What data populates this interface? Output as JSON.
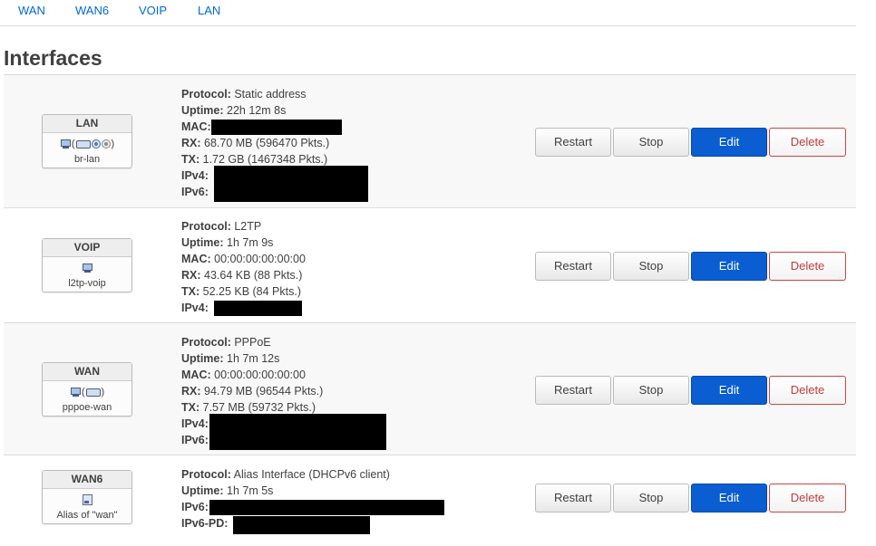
{
  "tabs": [
    "WAN",
    "WAN6",
    "VOIP",
    "LAN"
  ],
  "page_title": "Interfaces",
  "buttons": {
    "restart": "Restart",
    "stop": "Stop",
    "edit": "Edit",
    "delete": "Delete"
  },
  "interfaces": [
    {
      "name": "LAN",
      "device": "br-lan",
      "icons": [
        "ethernet-port-icon",
        "bridge-group-icon",
        "wireless-icon",
        "wireless-disabled-icon"
      ],
      "details": [
        {
          "label": "Protocol:",
          "value": " Static address"
        },
        {
          "label": "Uptime:",
          "value": " 22h 12m 8s"
        },
        {
          "label": "MAC:",
          "value": ""
        },
        {
          "label": "RX:",
          "value": " 68.70 MB (596470 Pkts.)"
        },
        {
          "label": "TX:",
          "value": " 1.72 GB (1467348 Pkts.)"
        },
        {
          "label": "IPv4:",
          "value": ""
        },
        {
          "label": "IPv6:",
          "value": ""
        }
      ]
    },
    {
      "name": "VOIP",
      "device": "l2tp-voip",
      "icons": [
        "tunnel-icon"
      ],
      "details": [
        {
          "label": "Protocol:",
          "value": " L2TP"
        },
        {
          "label": "Uptime:",
          "value": " 1h 7m 9s"
        },
        {
          "label": "MAC:",
          "value": " 00:00:00:00:00:00"
        },
        {
          "label": "RX:",
          "value": " 43.64 KB (88 Pkts.)"
        },
        {
          "label": "TX:",
          "value": " 52.25 KB (84 Pkts.)"
        },
        {
          "label": "IPv4:",
          "value": ""
        }
      ]
    },
    {
      "name": "WAN",
      "device": "pppoe-wan",
      "icons": [
        "tunnel-icon",
        "dsl-connection-icon"
      ],
      "details": [
        {
          "label": "Protocol:",
          "value": " PPPoE"
        },
        {
          "label": "Uptime:",
          "value": " 1h 7m 12s"
        },
        {
          "label": "MAC:",
          "value": " 00:00:00:00:00:00"
        },
        {
          "label": "RX:",
          "value": " 94.79 MB (96544 Pkts.)"
        },
        {
          "label": "TX:",
          "value": " 7.57 MB (59732 Pkts.)"
        },
        {
          "label": "IPv4:",
          "value": ""
        },
        {
          "label": "IPv6:",
          "value": ""
        }
      ]
    },
    {
      "name": "WAN6",
      "device": "Alias of \"wan\"",
      "icons": [
        "alias-icon"
      ],
      "details": [
        {
          "label": "Protocol:",
          "value": " Alias Interface (DHCPv6 client)"
        },
        {
          "label": "Uptime:",
          "value": " 1h 7m 5s"
        },
        {
          "label": "IPv6:",
          "value": ""
        },
        {
          "label": "IPv6-PD:",
          "value": ""
        }
      ]
    }
  ],
  "colors": {
    "link": "#0069d6",
    "edit_button": "#0a5ed1",
    "delete_text": "#c43c3c",
    "row_bg": "#f8f8f8"
  }
}
